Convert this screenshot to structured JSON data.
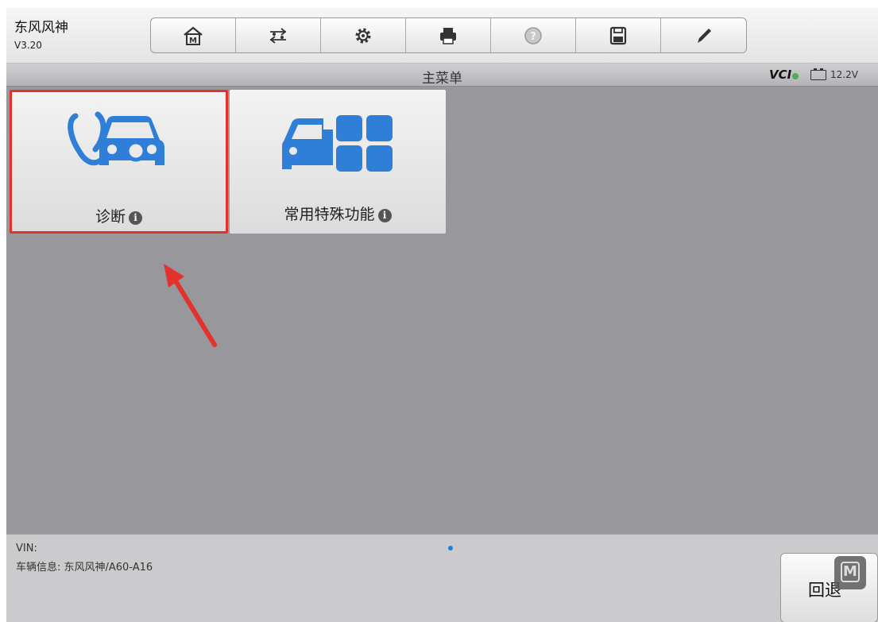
{
  "header": {
    "app_title": "东风风神",
    "version": "V3.20",
    "toolbar": [
      {
        "icon": "home-icon",
        "label": "M"
      },
      {
        "icon": "vehicle-swap-icon"
      },
      {
        "icon": "settings-gear-icon"
      },
      {
        "icon": "printer-icon"
      },
      {
        "icon": "help-icon"
      },
      {
        "icon": "save-icon"
      },
      {
        "icon": "edit-pencil-icon"
      }
    ]
  },
  "titlebar": {
    "title": "主菜单",
    "vci": "VCI",
    "battery": "12.2V"
  },
  "tiles": [
    {
      "label": "诊断",
      "icon": "diagnosis-stethoscope-car-icon",
      "selected": true
    },
    {
      "label": "常用特殊功能",
      "icon": "special-functions-car-grid-icon",
      "selected": false
    }
  ],
  "footer": {
    "vin": "VIN:",
    "vehicle_info": "车辆信息: 东风风神/A60-A16",
    "back_label": "回退"
  },
  "overlay": {
    "badge": "M"
  },
  "colors": {
    "accent_blue": "#2f7fd8",
    "highlight_red": "#e3312c"
  }
}
